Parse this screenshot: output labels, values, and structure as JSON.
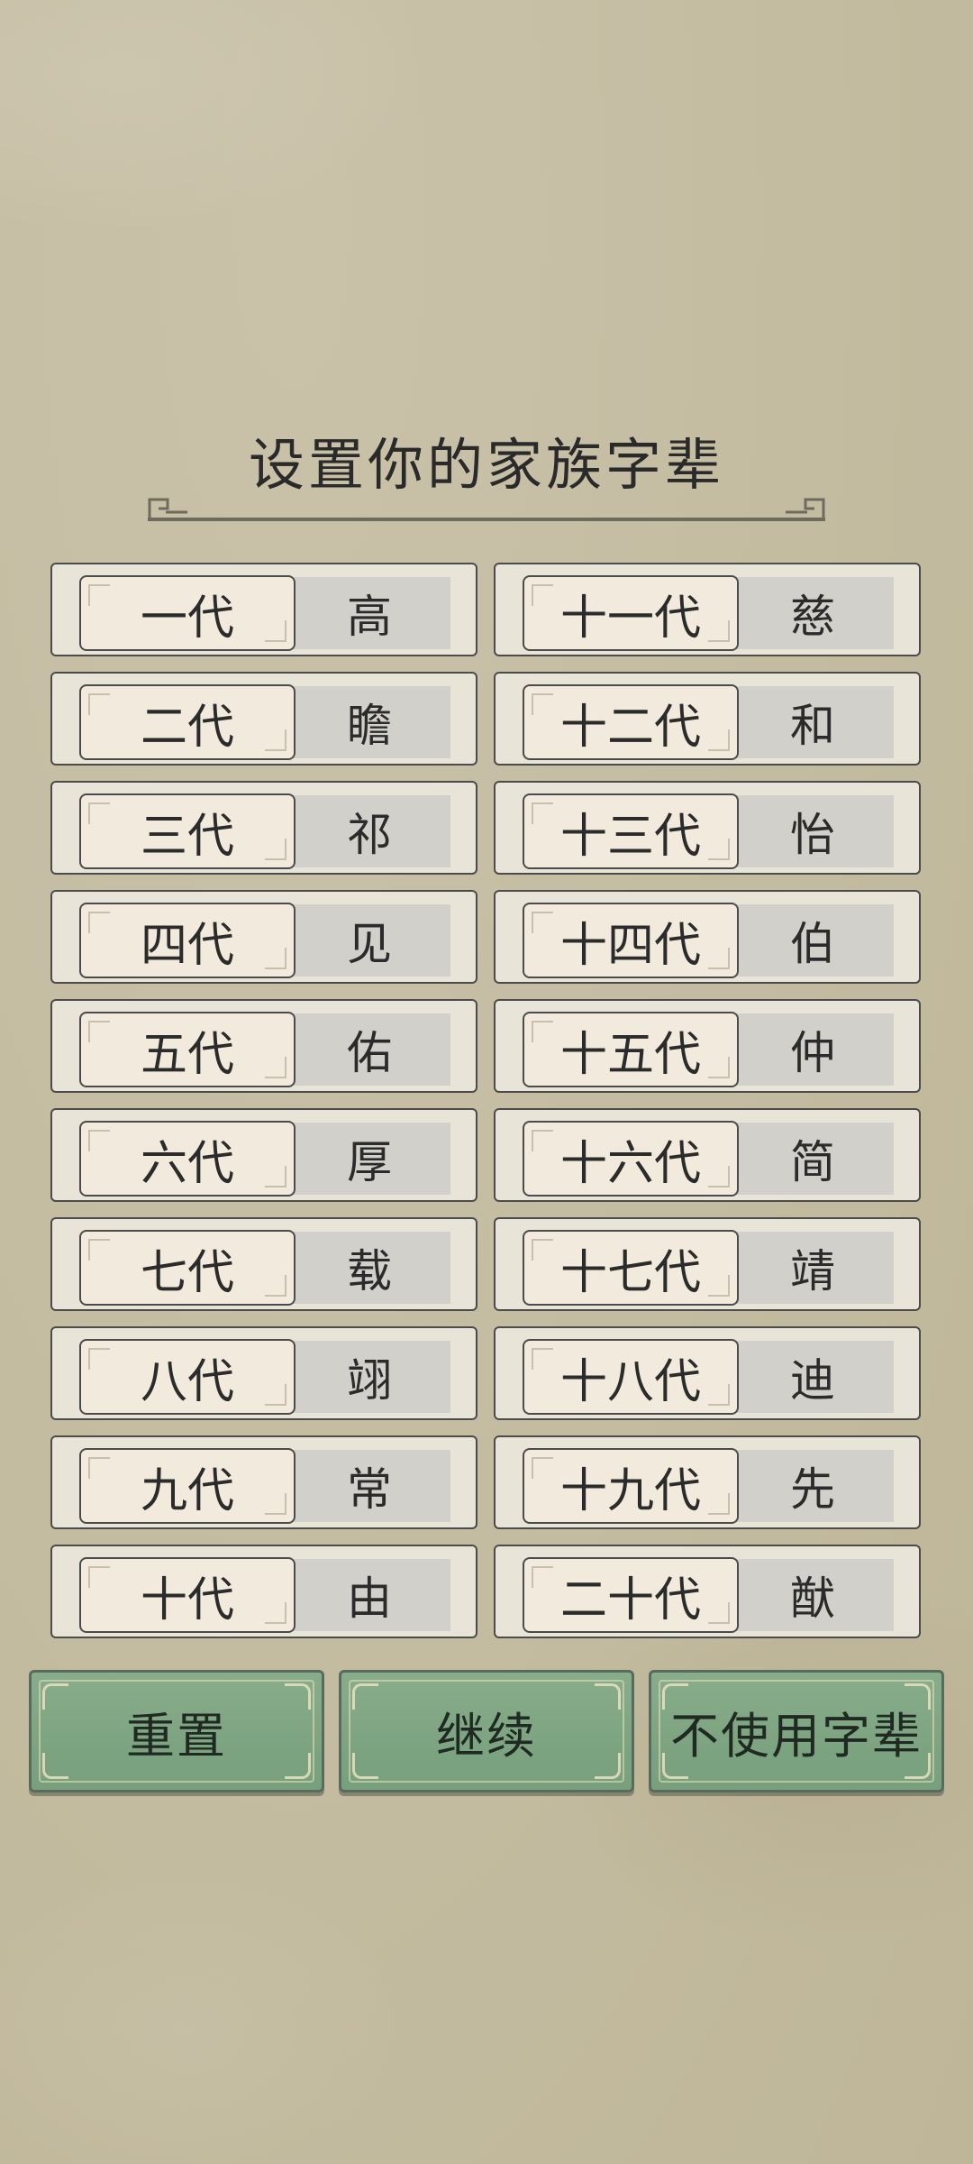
{
  "title": "设置你的家族字辈",
  "generations_left": [
    {
      "label": "一代",
      "char": "高"
    },
    {
      "label": "二代",
      "char": "瞻"
    },
    {
      "label": "三代",
      "char": "祁"
    },
    {
      "label": "四代",
      "char": "见"
    },
    {
      "label": "五代",
      "char": "佑"
    },
    {
      "label": "六代",
      "char": "厚"
    },
    {
      "label": "七代",
      "char": "载"
    },
    {
      "label": "八代",
      "char": "翊"
    },
    {
      "label": "九代",
      "char": "常"
    },
    {
      "label": "十代",
      "char": "由"
    }
  ],
  "generations_right": [
    {
      "label": "十一代",
      "char": "慈"
    },
    {
      "label": "十二代",
      "char": "和"
    },
    {
      "label": "十三代",
      "char": "怡"
    },
    {
      "label": "十四代",
      "char": "伯"
    },
    {
      "label": "十五代",
      "char": "仲"
    },
    {
      "label": "十六代",
      "char": "简"
    },
    {
      "label": "十七代",
      "char": "靖"
    },
    {
      "label": "十八代",
      "char": "迪"
    },
    {
      "label": "十九代",
      "char": "先"
    },
    {
      "label": "二十代",
      "char": "猷"
    }
  ],
  "buttons": {
    "reset": "重置",
    "continue": "继续",
    "skip": "不使用字辈"
  },
  "colors": {
    "background": "#c6bea3",
    "button_green": "#80a684",
    "cell_bg": "#e8e4d8",
    "field_bg": "#d2d0ca"
  }
}
